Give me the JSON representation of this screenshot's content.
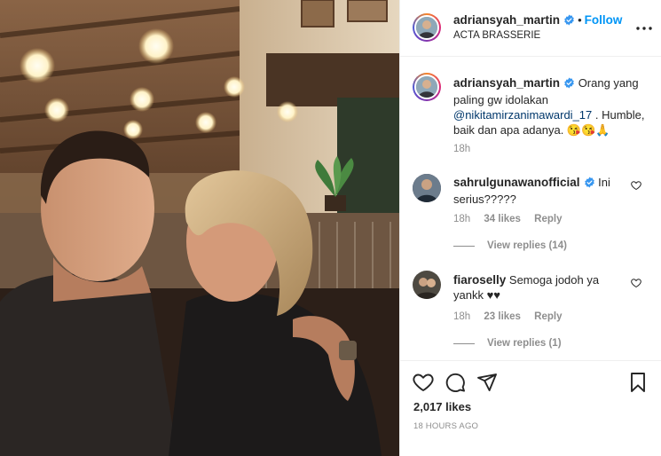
{
  "post": {
    "author": "adriansyah_martin",
    "follow_label": "Follow",
    "separator": "•",
    "location": "ACTA BRASSERIE",
    "photo_alt": ""
  },
  "caption": {
    "username": "adriansyah_martin",
    "text_before": "Orang yang paling gw idolakan",
    "mention": "@nikitamirzanimawardi_17",
    "text_after": " . Humble, baik dan apa adanya. 😘😘🙏",
    "time": "18h"
  },
  "comments": [
    {
      "username": "sahrulgunawanofficial",
      "verified": true,
      "text": "Ini serius?????",
      "time": "18h",
      "likes": "34 likes",
      "reply_label": "Reply",
      "view_replies": "View replies (14)"
    },
    {
      "username": "fiaroselly",
      "verified": false,
      "text": "Semoga jodoh ya yankk ♥♥",
      "time": "18h",
      "likes": "23 likes",
      "reply_label": "Reply",
      "view_replies": "View replies (1)"
    }
  ],
  "footer": {
    "likes": "2,017 likes",
    "time_ago": "18 HOURS AGO"
  },
  "colors": {
    "accent": "#0095f6",
    "verified": "#3897f0",
    "muted": "#8e8e8e",
    "text": "#262626"
  },
  "icons": [
    "verified-badge-icon",
    "more-options-icon",
    "heart-icon",
    "comment-icon",
    "share-icon",
    "save-bookmark-icon"
  ]
}
